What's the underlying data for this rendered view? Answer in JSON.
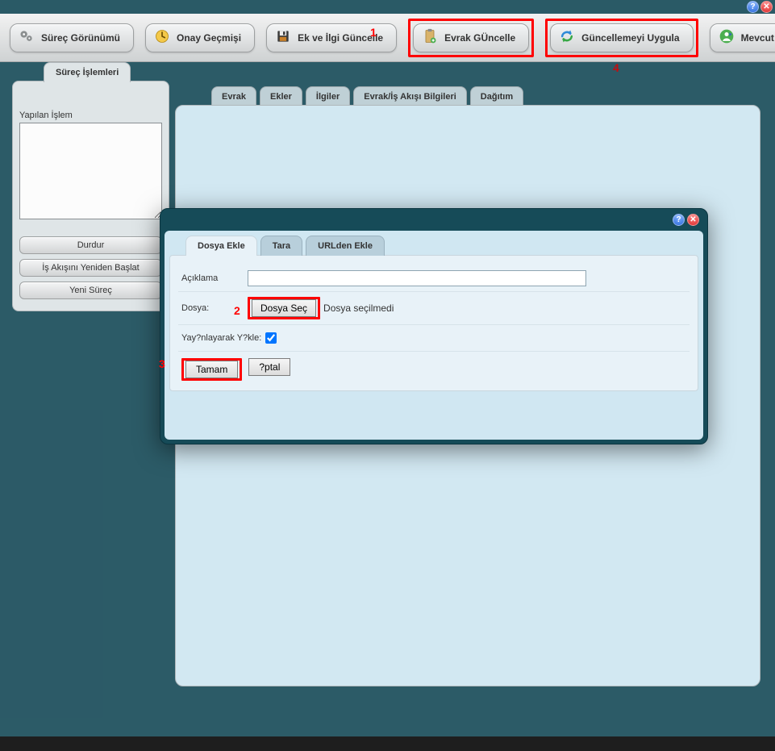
{
  "top": {
    "help": "?",
    "close": "✕"
  },
  "toolbar": {
    "btn1": "Süreç Görünümü",
    "btn2": "Onay Geçmişi",
    "btn3": "Ek ve İlgi Güncelle",
    "btn4": "Evrak GÜncelle",
    "btn5": "Güncellemeyi Uygula",
    "btn6": "Mevcut Evrak"
  },
  "callouts": {
    "c1": "1",
    "c2": "2",
    "c3": "3",
    "c4": "4"
  },
  "sidebar": {
    "tab": "Süreç İşlemleri",
    "textarea_label": "Yapılan İşlem",
    "btn_durdur": "Durdur",
    "btn_restart": "İş Akışını Yeniden Başlat",
    "btn_yeni": "Yeni Süreç"
  },
  "maintabs": {
    "t1": "Evrak",
    "t2": "Ekler",
    "t3": "İlgiler",
    "t4": "Evrak/İş Akışı Bilgileri",
    "t5": "Dağıtım"
  },
  "modal": {
    "tabs": {
      "t1": "Dosya Ekle",
      "t2": "Tara",
      "t3": "URLden Ekle"
    },
    "aciklama_label": "Açıklama",
    "dosya_label": "Dosya:",
    "file_button": "Dosya Seç",
    "file_status": "Dosya seçilmedi",
    "yayin_label": "Yay?nlayarak Y?kle:",
    "btn_tamam": "Tamam",
    "btn_iptal": "?ptal"
  }
}
